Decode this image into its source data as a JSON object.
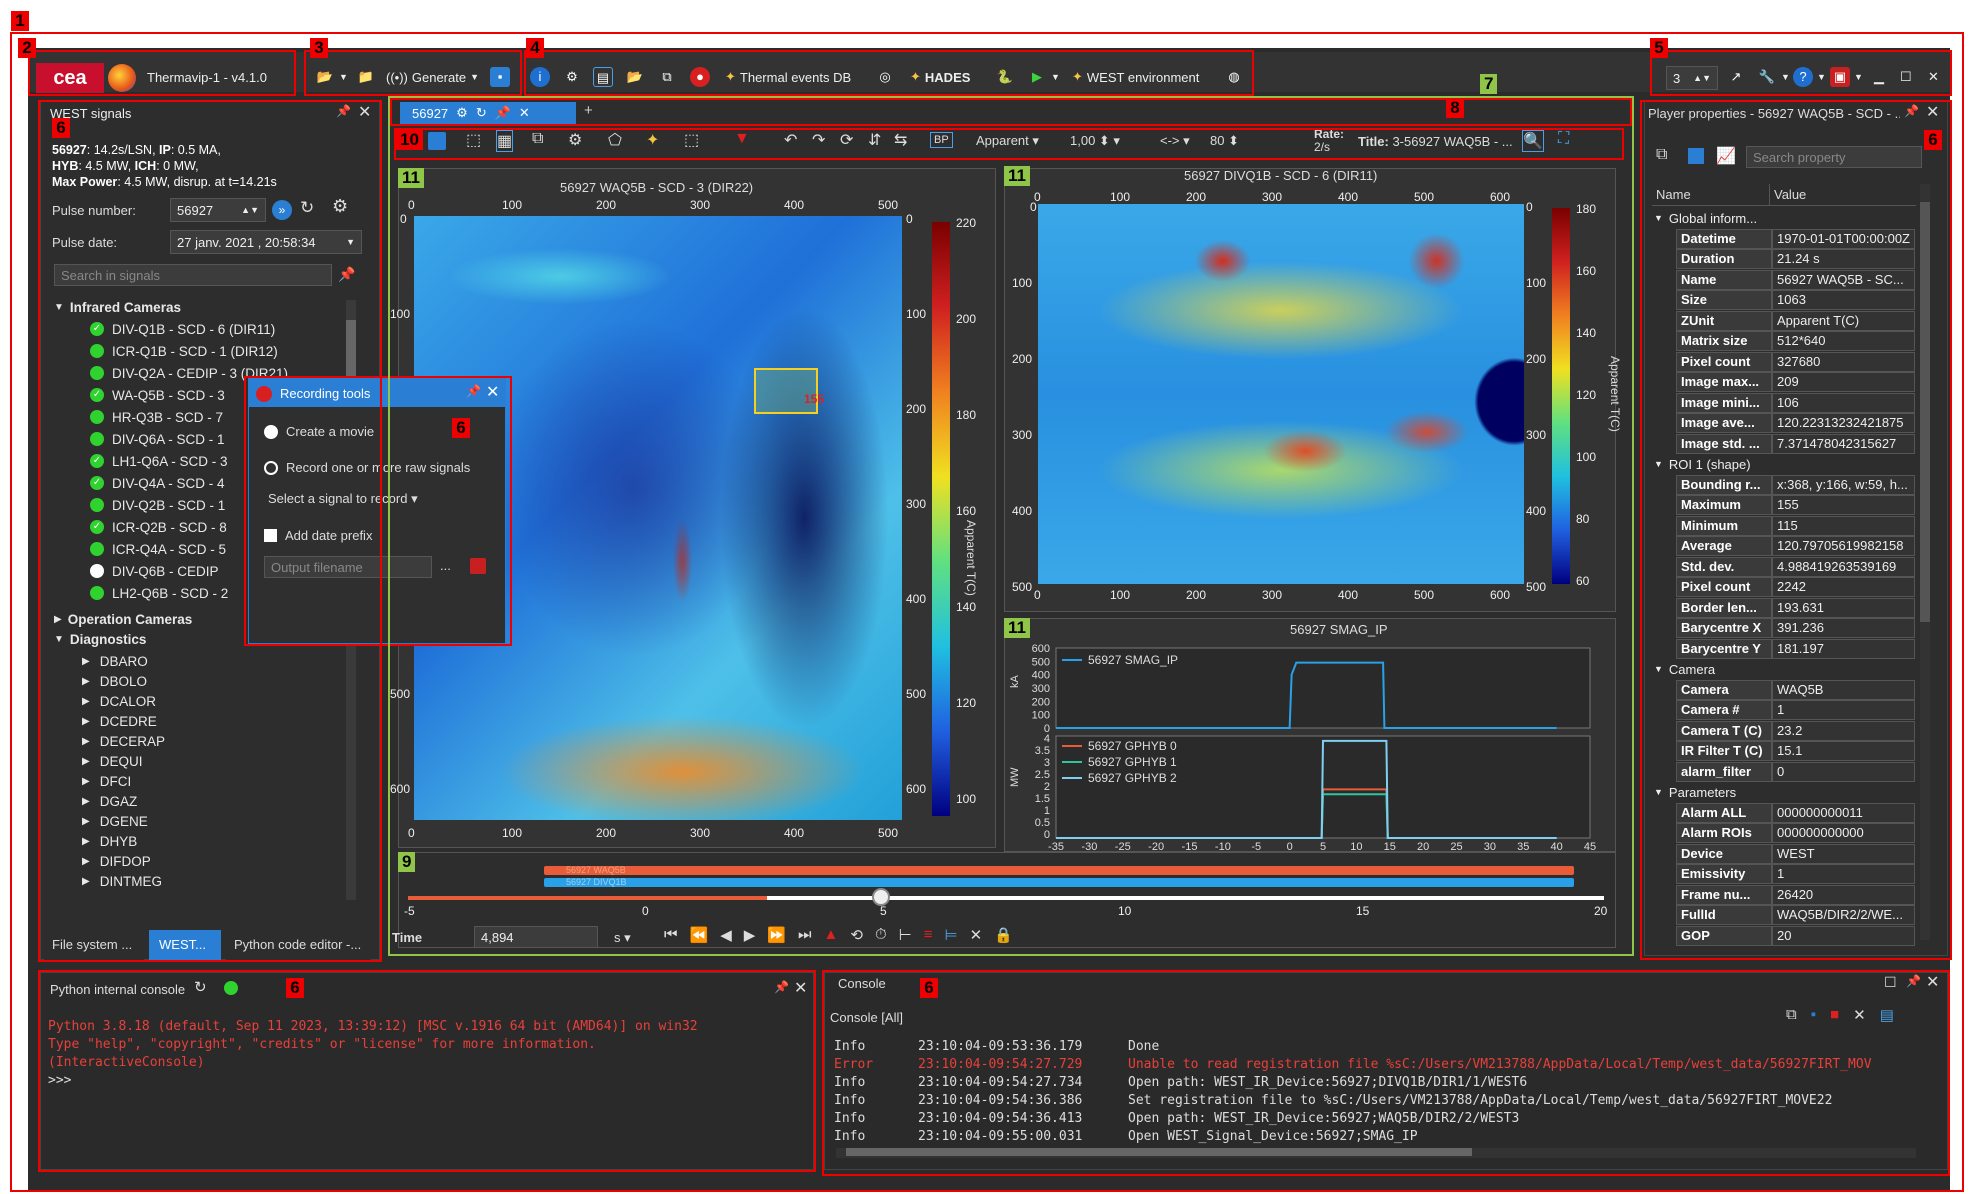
{
  "app": {
    "title": "Thermavip-1 - v4.1.0",
    "logo_text": "cea"
  },
  "toolbar": {
    "generate_label": "Generate",
    "thermal_events_label": "Thermal events DB",
    "hades_label": "HADES",
    "west_env_label": "WEST environment",
    "count_value": "3"
  },
  "left_panel": {
    "title": "WEST signals",
    "info_line1_bold": "56927",
    "info_line1": ": 14.2s/LSN, ",
    "info_ip_bold": "IP",
    "info_ip": ": 0.5 MA,",
    "info_line2_hyb_bold": "HYB",
    "info_line2_hyb": ": 4.5 MW, ",
    "info_line2_ich_bold": "ICH",
    "info_line2_ich": ": 0 MW,",
    "info_line3_bold": "Max Power",
    "info_line3": ": 4.5 MW, disrup. at t=14.21s",
    "pulse_number_label": "Pulse number:",
    "pulse_number_value": "56927",
    "pulse_date_label": "Pulse date:",
    "pulse_date_value": "27 janv. 2021 , 20:58:34",
    "search_placeholder": "Search in signals",
    "tree": {
      "infrared_label": "Infrared Cameras",
      "cameras": [
        {
          "label": "DIV-Q1B - SCD - 6 (DIR11)",
          "state": "check"
        },
        {
          "label": "ICR-Q1B - SCD - 1 (DIR12)",
          "state": "dot"
        },
        {
          "label": "DIV-Q2A - CEDIP - 3 (DIR21)",
          "state": "dot"
        },
        {
          "label": "WA-Q5B - SCD - 3",
          "state": "check"
        },
        {
          "label": "HR-Q3B - SCD - 7",
          "state": "dot"
        },
        {
          "label": "DIV-Q6A - SCD - 1",
          "state": "dot"
        },
        {
          "label": "LH1-Q6A - SCD - 3",
          "state": "check"
        },
        {
          "label": "DIV-Q4A - SCD - 4",
          "state": "check"
        },
        {
          "label": "DIV-Q2B - SCD - 1",
          "state": "dot"
        },
        {
          "label": "ICR-Q2B - SCD - 8",
          "state": "check"
        },
        {
          "label": "ICR-Q4A - SCD - 5",
          "state": "dot"
        },
        {
          "label": "DIV-Q6B - CEDIP",
          "state": "white"
        },
        {
          "label": "LH2-Q6B - SCD - 2",
          "state": "dot"
        }
      ],
      "operation_label": "Operation Cameras",
      "diagnostics_label": "Diagnostics",
      "diagnostics": [
        "DBARO",
        "DBOLO",
        "DCALOR",
        "DCEDRE",
        "DECERAP",
        "DEQUI",
        "DFCI",
        "DGAZ",
        "DGENE",
        "DHYB",
        "DIFDOP",
        "DINTMEG"
      ]
    },
    "tabs": [
      "File system ...",
      "WEST...",
      "Python code editor -..."
    ]
  },
  "recording": {
    "title": "Recording tools",
    "opt1": "Create a movie",
    "opt2": "Record one or more raw signals",
    "select_label": "Select a signal to record",
    "date_prefix": "Add date prefix",
    "filename_placeholder": "Output filename",
    "dots": "..."
  },
  "center": {
    "tab_label": "56927",
    "plus": "+",
    "toolbar": {
      "bp": "BP",
      "unit": "Apparent",
      "value1": "1,00",
      "arrows": "<->",
      "value2": "80",
      "rate_label": "Rate:",
      "rate_value": "2/s",
      "title_label": "Title:",
      "title_value": "3-56927 WAQ5B - ..."
    },
    "view1": {
      "title": "56927 WAQ5B - SCD - 3 (DIR22)",
      "xticks": [
        "0",
        "100",
        "200",
        "300",
        "400",
        "500"
      ],
      "yticks": [
        "0",
        "100",
        "200",
        "300",
        "400",
        "500",
        "600"
      ],
      "cbar_ticks": [
        "220",
        "200",
        "180",
        "160",
        "140",
        "120",
        "100"
      ],
      "cbar_label": "Apparent T(C)",
      "roi_value": "155"
    },
    "view2": {
      "title": "56927 DIVQ1B - SCD - 6 (DIR11)",
      "xticks": [
        "0",
        "100",
        "200",
        "300",
        "400",
        "500",
        "600"
      ],
      "yticks": [
        "0",
        "100",
        "200",
        "300",
        "400",
        "500"
      ],
      "cbar_ticks": [
        "180",
        "160",
        "140",
        "120",
        "100",
        "80",
        "60"
      ],
      "cbar_label": "Apparent T(C)"
    },
    "plot": {
      "title": "56927 SMAG_IP",
      "ylabel_top": "kA",
      "ylabel_bottom": "MW",
      "xlabel": "Time",
      "legend_top": "56927 SMAG_IP",
      "legend_bottom": [
        "56927 GPHYB 0",
        "56927 GPHYB 1",
        "56927 GPHYB 2"
      ],
      "xticks": [
        "-35",
        "-30",
        "-25",
        "-20",
        "-15",
        "-10",
        "-5",
        "0",
        "5",
        "10",
        "15",
        "20",
        "25",
        "30",
        "35",
        "40",
        "45"
      ],
      "yticks_top": [
        "600",
        "500",
        "400",
        "300",
        "200",
        "100",
        "0"
      ],
      "yticks_bottom": [
        "4",
        "3.5",
        "3",
        "2.5",
        "2",
        "1.5",
        "1",
        "0.5",
        "0"
      ]
    },
    "timeline": {
      "bar1": "56927 WAQ5B",
      "bar2": "56927 DIVQ1B",
      "ticks": [
        "-5",
        "0",
        "5",
        "10",
        "15",
        "20"
      ],
      "time_label": "Time",
      "time_value": "4,894",
      "unit": "s"
    }
  },
  "chart_data": {
    "type": "line",
    "title": "56927 SMAG_IP",
    "series": [
      {
        "name": "56927 SMAG_IP",
        "color": "#2aa0e8",
        "x": [
          -35,
          0,
          0.3,
          1,
          14,
          14.2,
          40
        ],
        "y": [
          0,
          0,
          400,
          490,
          490,
          0,
          0
        ]
      },
      {
        "name": "56927 GPHYB 0",
        "color": "#e85c3a",
        "x": [
          -35,
          4.8,
          5,
          14.5,
          14.7,
          40
        ],
        "y": [
          0,
          0,
          2.0,
          2.0,
          0,
          0
        ]
      },
      {
        "name": "56927 GPHYB 1",
        "color": "#2ec4a0",
        "x": [
          -35,
          4.8,
          5,
          14.5,
          14.7,
          40
        ],
        "y": [
          0,
          0,
          1.8,
          1.8,
          0,
          0
        ]
      },
      {
        "name": "56927 GPHYB 2",
        "color": "#7fd0f0",
        "x": [
          -35,
          4.8,
          5,
          14.5,
          14.7,
          40
        ],
        "y": [
          0,
          0,
          4.0,
          4.0,
          0,
          0
        ]
      }
    ],
    "xlabel": "Time",
    "xlim": [
      -35,
      45
    ]
  },
  "props": {
    "title": "Player properties - 56927 WAQ5B - SCD - ...",
    "search_placeholder": "Search property",
    "col_name": "Name",
    "col_value": "Value",
    "group_global": "Global inform...",
    "global": [
      [
        "Datetime",
        "1970-01-01T00:00:00Z"
      ],
      [
        "Duration",
        "21.24 s"
      ],
      [
        "Name",
        "56927 WAQ5B - SC..."
      ],
      [
        "Size",
        "1063"
      ],
      [
        "ZUnit",
        "Apparent T(C)"
      ],
      [
        "Matrix size",
        "512*640"
      ],
      [
        "Pixel count",
        "327680"
      ],
      [
        "Image max...",
        "209"
      ],
      [
        "Image mini...",
        "106"
      ],
      [
        "Image ave...",
        "120.22313232421875"
      ],
      [
        "Image std. ...",
        "7.371478042315627"
      ]
    ],
    "group_roi": "ROI 1 (shape)",
    "roi": [
      [
        "Bounding r...",
        "x:368, y:166, w:59, h..."
      ],
      [
        "Maximum",
        "155"
      ],
      [
        "Minimum",
        "115"
      ],
      [
        "Average",
        "120.79705619982158"
      ],
      [
        "Std. dev.",
        "4.988419263539169"
      ],
      [
        "Pixel count",
        "2242"
      ],
      [
        "Border len...",
        "193.631"
      ],
      [
        "Barycentre X",
        "391.236"
      ],
      [
        "Barycentre Y",
        "181.197"
      ]
    ],
    "group_camera": "Camera",
    "camera": [
      [
        "Camera",
        "WAQ5B"
      ],
      [
        "Camera #",
        "1"
      ],
      [
        "Camera T (C)",
        "23.2"
      ],
      [
        "IR Filter T (C)",
        "15.1"
      ],
      [
        "alarm_filter",
        "0"
      ]
    ],
    "group_params": "Parameters",
    "params": [
      [
        "Alarm ALL",
        "000000000011"
      ],
      [
        "Alarm ROIs",
        "000000000000"
      ],
      [
        "Device",
        "WEST"
      ],
      [
        "Emissivity",
        "1"
      ],
      [
        "Frame nu...",
        "26420"
      ],
      [
        "FullId",
        "WAQ5B/DIR2/2/WE..."
      ],
      [
        "GOP",
        "20"
      ]
    ]
  },
  "python_console": {
    "title": "Python internal console",
    "lines": [
      "Python 3.8.18 (default, Sep 11 2023, 13:39:12) [MSC v.1916 64 bit (AMD64)] on win32",
      "Type \"help\", \"copyright\", \"credits\" or \"license\" for more information.",
      "(InteractiveConsole)"
    ],
    "prompt": ">>>"
  },
  "console": {
    "title": "Console",
    "subtitle": "Console [All]",
    "rows": [
      {
        "level": "Info",
        "time": "23:10:04-09:53:36.179",
        "msg": "Done"
      },
      {
        "level": "Error",
        "time": "23:10:04-09:54:27.729",
        "msg": "Unable to read registration file %sC:/Users/VM213788/AppData/Local/Temp/west_data/56927FIRT_MOV"
      },
      {
        "level": "Info",
        "time": "23:10:04-09:54:27.734",
        "msg": "Open path: WEST_IR_Device:56927;DIVQ1B/DIR1/1/WEST6"
      },
      {
        "level": "Info",
        "time": "23:10:04-09:54:36.386",
        "msg": "Set registration file to %sC:/Users/VM213788/AppData/Local/Temp/west_data/56927FIRT_MOVE22"
      },
      {
        "level": "Info",
        "time": "23:10:04-09:54:36.413",
        "msg": "Open path: WEST_IR_Device:56927;WAQ5B/DIR2/2/WEST3"
      },
      {
        "level": "Info",
        "time": "23:10:04-09:55:00.031",
        "msg": "Open WEST_Signal_Device:56927;SMAG_IP"
      }
    ]
  },
  "annotations": [
    "1",
    "2",
    "3",
    "4",
    "5",
    "6",
    "7",
    "8",
    "9",
    "10",
    "11"
  ]
}
